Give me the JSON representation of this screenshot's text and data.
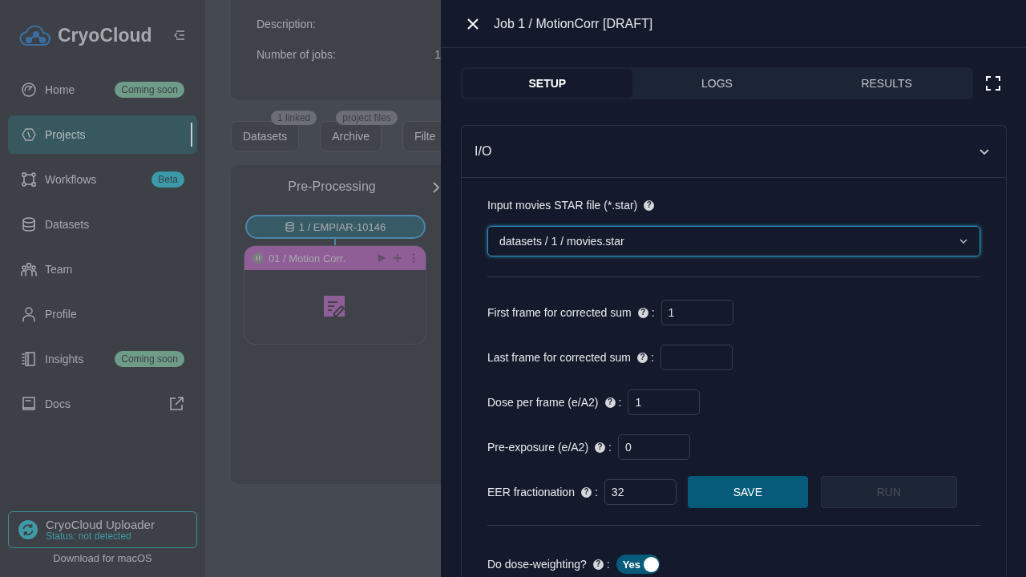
{
  "sidebar": {
    "brand": "CryoCloud",
    "items": [
      {
        "label": "Home",
        "selected": false,
        "badge": {
          "text": "Coming soon",
          "color": "#6f9c88"
        }
      },
      {
        "label": "Projects",
        "selected": true
      },
      {
        "label": "Workflows",
        "selected": false,
        "badge": {
          "text": "Beta",
          "color": "#3a9aa8"
        }
      },
      {
        "label": "Datasets",
        "selected": false
      },
      {
        "label": "Team",
        "selected": false
      },
      {
        "label": "Profile",
        "selected": false
      },
      {
        "label": "Insights",
        "selected": false,
        "badge": {
          "text": "Coming soon",
          "color": "#6f9c88"
        }
      },
      {
        "label": "Docs",
        "selected": false,
        "external": true
      }
    ],
    "uploader": {
      "title": "CryoCloud Uploader",
      "status": "Status: not detected",
      "download": "Download for macOS"
    }
  },
  "project": {
    "details": [
      {
        "label": "Description:"
      },
      {
        "label": "Number of jobs:",
        "value": "1"
      }
    ],
    "tabs": [
      {
        "label": "Datasets",
        "badge": "1 linked"
      },
      {
        "label": "Archive",
        "badge": "project files"
      },
      {
        "label": "Filte"
      }
    ],
    "pipeline": {
      "title": "Pre-Processing",
      "dataset": "1 / EMPIAR-10146",
      "job": "01 / Motion Corr."
    }
  },
  "drawer": {
    "title": "Job 1 / MotionCorr [DRAFT]",
    "tabs": [
      {
        "label": "SETUP",
        "selected": true
      },
      {
        "label": "LOGS",
        "selected": false
      },
      {
        "label": "RESULTS",
        "selected": false
      }
    ],
    "section": {
      "title": "I/O",
      "expanded": true,
      "input_file": {
        "label": "Input movies STAR file (*.star)",
        "help": "?",
        "value": "datasets / 1 / movies.star"
      },
      "fields": [
        {
          "label": "First frame for corrected sum",
          "help": "?",
          "separator": ":",
          "value": "1"
        },
        {
          "label": "Last frame for corrected sum",
          "help": "?",
          "separator": ":"
        },
        {
          "label": "Dose per frame (e/A2)",
          "help": "?",
          "separator": ":",
          "value": "1"
        },
        {
          "label": "Pre-exposure (e/A2)",
          "help": "?",
          "separator": ":",
          "value": "0"
        },
        {
          "label": "EER fractionation",
          "help": "?",
          "separator": ":",
          "value": "32"
        }
      ],
      "buttons": [
        {
          "label": "SAVE",
          "disabled": false
        },
        {
          "label": "RUN",
          "disabled": true
        }
      ],
      "toggles": [
        {
          "label": "Do dose-weighting?",
          "help": "?",
          "separator": ":",
          "on": true,
          "text": "Yes"
        }
      ]
    }
  }
}
